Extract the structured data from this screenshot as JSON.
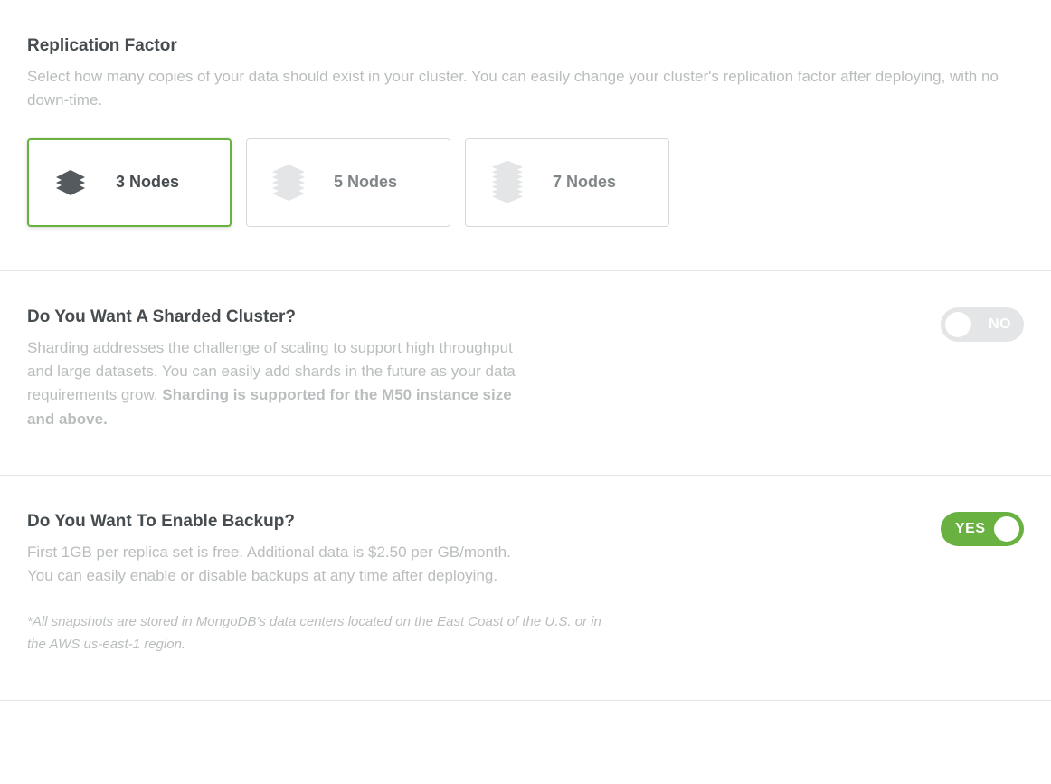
{
  "replication": {
    "title": "Replication Factor",
    "desc": "Select how many copies of your data should exist in your cluster. You can easily change your cluster's replication factor after deploying, with no down-time.",
    "options": [
      {
        "label": "3 Nodes",
        "layers": 3,
        "selected": true
      },
      {
        "label": "5 Nodes",
        "layers": 5,
        "selected": false
      },
      {
        "label": "7 Nodes",
        "layers": 7,
        "selected": false
      }
    ]
  },
  "sharding": {
    "title": "Do You Want A Sharded Cluster?",
    "desc_part1": "Sharding addresses the challenge of scaling to support high throughput and large datasets. You can easily add shards in the future as your data requirements grow. ",
    "desc_bold": "Sharding is supported for the M50 instance size and above.",
    "toggle": {
      "state": "off",
      "label": "NO"
    }
  },
  "backup": {
    "title": "Do You Want To Enable Backup?",
    "desc": "First 1GB per replica set is free. Additional data is $2.50 per GB/month. You can easily enable or disable backups at any time after deploying.",
    "note": "*All snapshots are stored in MongoDB's data centers located on the East Coast of the U.S. or in the AWS us-east-1 region.",
    "toggle": {
      "state": "on",
      "label": "YES"
    }
  }
}
